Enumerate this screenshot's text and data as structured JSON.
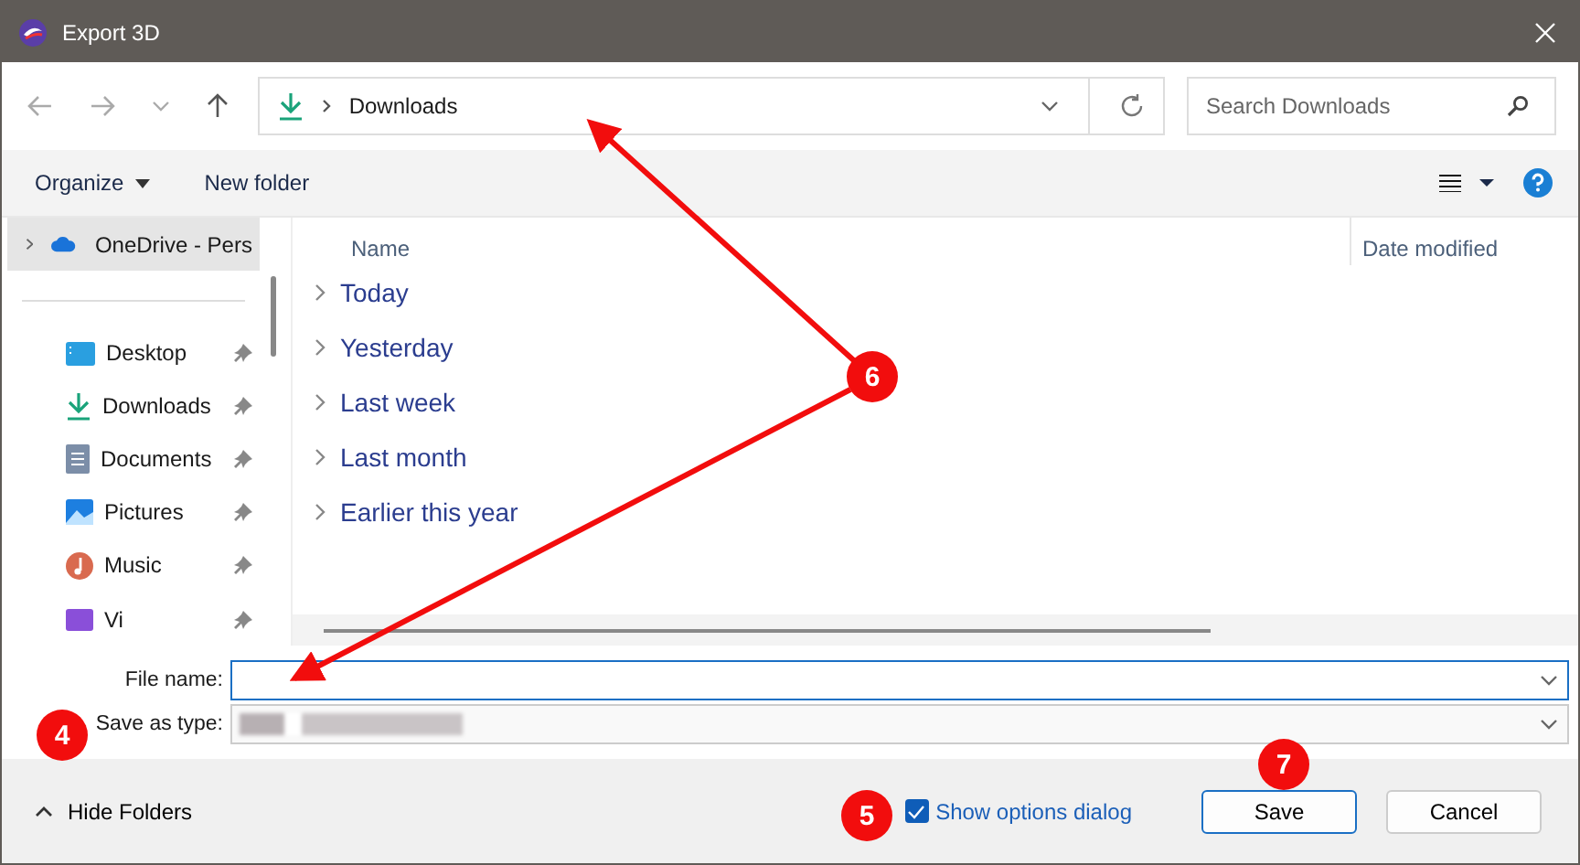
{
  "window": {
    "title": "Export 3D"
  },
  "address_bar": {
    "path": "Downloads"
  },
  "search": {
    "placeholder": "Search Downloads"
  },
  "toolbar": {
    "organize": "Organize",
    "new_folder": "New folder"
  },
  "sidebar": {
    "items": [
      {
        "label": "OneDrive - Pers",
        "kind": "cloud",
        "selected": true,
        "pinned": false
      },
      {
        "label": "Desktop",
        "kind": "desktop",
        "selected": false,
        "pinned": true
      },
      {
        "label": "Downloads",
        "kind": "download",
        "selected": false,
        "pinned": true
      },
      {
        "label": "Documents",
        "kind": "document",
        "selected": false,
        "pinned": true
      },
      {
        "label": "Pictures",
        "kind": "picture",
        "selected": false,
        "pinned": true
      },
      {
        "label": "Music",
        "kind": "music",
        "selected": false,
        "pinned": true
      },
      {
        "label": "Vi",
        "kind": "video",
        "selected": false,
        "pinned": true
      }
    ]
  },
  "file_list": {
    "columns": [
      "Name",
      "Date modified"
    ],
    "groups": [
      "Today",
      "Yesterday",
      "Last week",
      "Last month",
      "Earlier this year"
    ]
  },
  "form": {
    "file_name_label": "File name:",
    "save_type_label": "Save as type:"
  },
  "footer": {
    "hide_folders": "Hide Folders",
    "show_options": {
      "label": "Show options dialog",
      "checked": true
    },
    "buttons": [
      "Save",
      "Cancel"
    ]
  },
  "annotations": [
    "6",
    "4",
    "5",
    "7"
  ]
}
